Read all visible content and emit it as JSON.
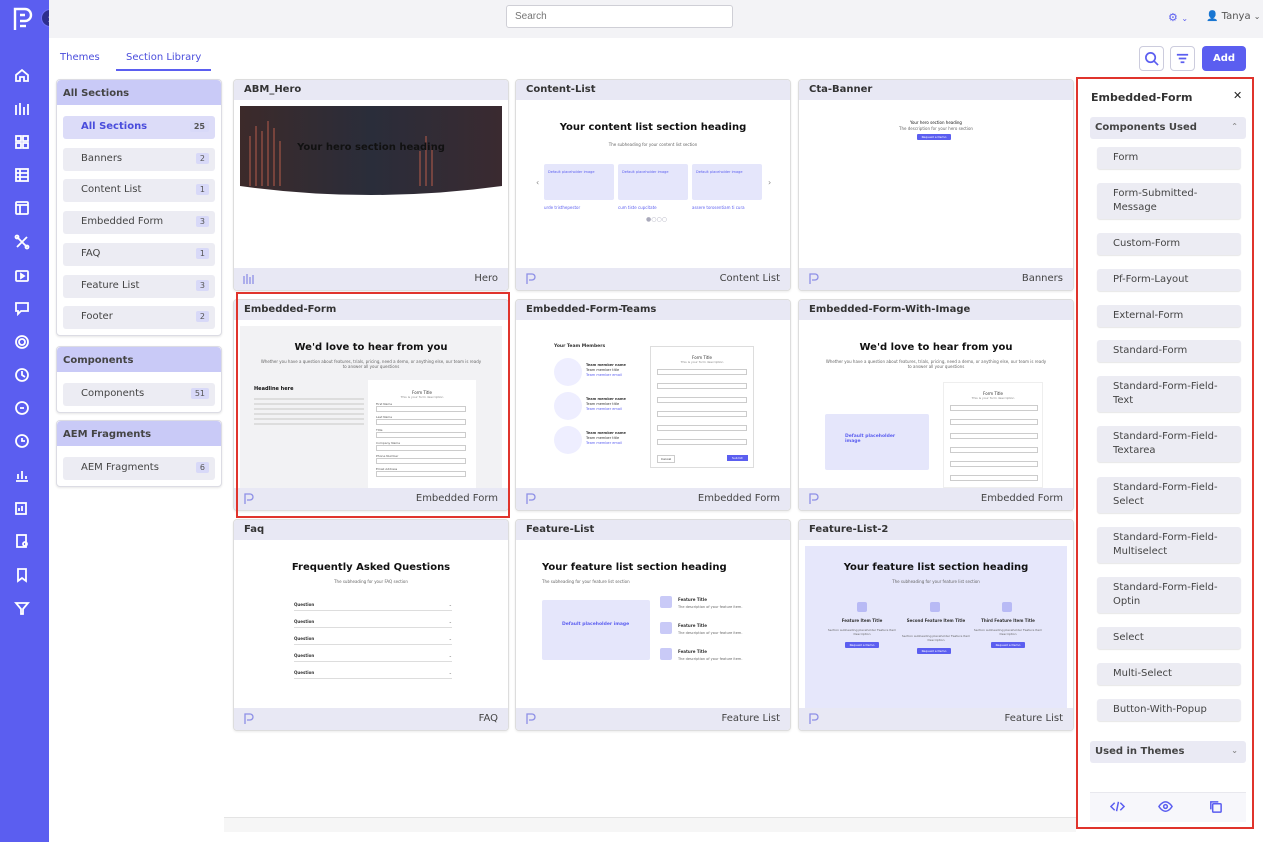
{
  "search": {
    "placeholder": "Search"
  },
  "user": {
    "name": "Tanya"
  },
  "tabs": [
    {
      "label": "Themes"
    },
    {
      "label": "Section Library"
    }
  ],
  "toolbar": {
    "add_label": "Add"
  },
  "filters": {
    "all_sections": {
      "heading": "All Sections",
      "items": [
        {
          "label": "All Sections",
          "count": "25"
        },
        {
          "label": "Banners",
          "count": "2"
        },
        {
          "label": "Content List",
          "count": "1"
        },
        {
          "label": "Embedded Form",
          "count": "3"
        },
        {
          "label": "FAQ",
          "count": "1"
        },
        {
          "label": "Feature List",
          "count": "3"
        },
        {
          "label": "Footer",
          "count": "2"
        }
      ]
    },
    "components": {
      "heading": "Components",
      "items": [
        {
          "label": "Components",
          "count": "51"
        }
      ]
    },
    "aem": {
      "heading": "AEM Fragments",
      "items": [
        {
          "label": "AEM Fragments",
          "count": "6"
        }
      ]
    }
  },
  "cards": [
    {
      "title": "ABM_Hero",
      "category": "Hero",
      "preview_heading": "Your hero section heading"
    },
    {
      "title": "Content-List",
      "category": "Content List",
      "preview_heading": "Your content list section heading",
      "preview_sub": "The subheading for your content list section",
      "items": [
        "Default placeholder image",
        "Default placeholder image",
        "Default placeholder image"
      ],
      "item_texts": [
        "urde tristhepestor",
        "cum tiste cupcitate",
        "assere torosentiam ti cura"
      ]
    },
    {
      "title": "Cta-Banner",
      "category": "Banners",
      "preview_heading": "Your hero section heading",
      "preview_sub": "The description for your hero section",
      "button": "Request a Demo"
    },
    {
      "title": "Embedded-Form",
      "category": "Embedded Form",
      "preview_heading": "We'd love to hear from you",
      "preview_sub": "Whether you have a question about features, trials, pricing, need a demo, or anything else, our team is ready to answer all your questions",
      "side_heading": "Headline here",
      "form_title": "Form Title",
      "form_sub": "This is your form description",
      "fields": [
        "First Name",
        "Last Name",
        "Title",
        "Company Name",
        "Phone Number",
        "Email Address"
      ]
    },
    {
      "title": "Embedded-Form-Teams",
      "category": "Embedded Form",
      "team_heading": "Your Team Members",
      "members": [
        {
          "name": "Team member name",
          "title": "Team member title",
          "email": "Team member email"
        },
        {
          "name": "Team member name",
          "title": "Team member title",
          "email": "Team member email"
        },
        {
          "name": "Team member name",
          "title": "Team member title",
          "email": "Team member email"
        }
      ],
      "form_title": "Form Title",
      "form_sub": "This is your form description",
      "fields": [
        "First Name",
        "Last Name",
        "Title",
        "Company Name",
        "Phone Number",
        "Email Address"
      ],
      "buttons": [
        "Cancel",
        "Submit"
      ]
    },
    {
      "title": "Embedded-Form-With-Image",
      "category": "Embedded Form",
      "preview_heading": "We'd love to hear from you",
      "preview_sub": "Whether you have a question about features, trials, pricing, need a demo, or anything else, our team is ready to answer all your questions",
      "image_label": "Default placeholder image",
      "form_title": "Form Title",
      "form_sub": "This is your form description",
      "fields": [
        "First Name",
        "Last Name",
        "Title",
        "Company Name",
        "Phone Number",
        "Email Address"
      ]
    },
    {
      "title": "Faq",
      "category": "FAQ",
      "preview_heading": "Frequently Asked Questions",
      "preview_sub": "The subheading for your FAQ section",
      "questions": [
        "Question",
        "Question",
        "Question",
        "Question",
        "Question"
      ]
    },
    {
      "title": "Feature-List",
      "category": "Feature List",
      "preview_heading": "Your feature list section heading",
      "preview_sub": "The subheading for your feature list section",
      "image_label": "Default placeholder image",
      "features": [
        {
          "title": "Feature Title",
          "desc": "The description of your feature item."
        },
        {
          "title": "Feature Title",
          "desc": "The description of your feature item."
        },
        {
          "title": "Feature Title",
          "desc": "The description of your feature item."
        }
      ]
    },
    {
      "title": "Feature-List-2",
      "category": "Feature List",
      "preview_heading": "Your feature list section heading",
      "preview_sub": "The subheading for your feature list section",
      "features": [
        {
          "title": "Feature Item Title",
          "desc": "Section subheading placeholder Feature Item Description",
          "button": "Request a Demo"
        },
        {
          "title": "Second Feature Item Title",
          "desc": "Section subheading placeholder Feature Item Description",
          "button": "Request a Demo"
        },
        {
          "title": "Third Feature Item Title",
          "desc": "Section subheading placeholder Feature Item Description",
          "button": "Request a Demo"
        }
      ]
    }
  ],
  "detail": {
    "title": "Embedded-Form",
    "components_heading": "Components Used",
    "components": [
      "Form",
      "Form-Submitted-Message",
      "Custom-Form",
      "Pf-Form-Layout",
      "External-Form",
      "Standard-Form",
      "Standard-Form-Field-Text",
      "Standard-Form-Field-Textarea",
      "Standard-Form-Field-Select",
      "Standard-Form-Field-Multiselect",
      "Standard-Form-Field-Optin",
      "Select",
      "Multi-Select",
      "Button-With-Popup"
    ],
    "themes_heading": "Used in Themes"
  },
  "colors": {
    "accent": "#5b5ef0",
    "highlight": "#e0342c",
    "panel_header": "#c9caf7"
  }
}
